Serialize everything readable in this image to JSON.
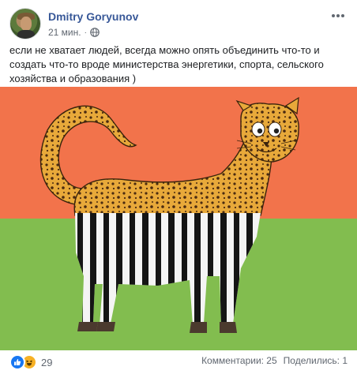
{
  "post": {
    "author": "Dmitry Goryunov",
    "time": "21 мин.",
    "separator": "·",
    "text": "если не хватает людей, всегда можно опять объединить что-то и создать что-то вроде министерства энергетики, спорта, сельского хозяйства и образования )",
    "privacy_icon": "globe-icon",
    "menu_icon": "more-options-icon"
  },
  "image": {
    "description_icon": "cheetah-zebra-illustration",
    "colors": {
      "top": "#f2734b",
      "bottom": "#82bd4f"
    }
  },
  "footer": {
    "reaction_icons": [
      "like-icon",
      "haha-icon"
    ],
    "reaction_count": "29",
    "comments": "Комментарии: 25",
    "shares": "Поделились: 1"
  },
  "colors": {
    "author": "#385898",
    "meta": "#606770",
    "like": "#1877f2",
    "haha": "#f7b125"
  }
}
